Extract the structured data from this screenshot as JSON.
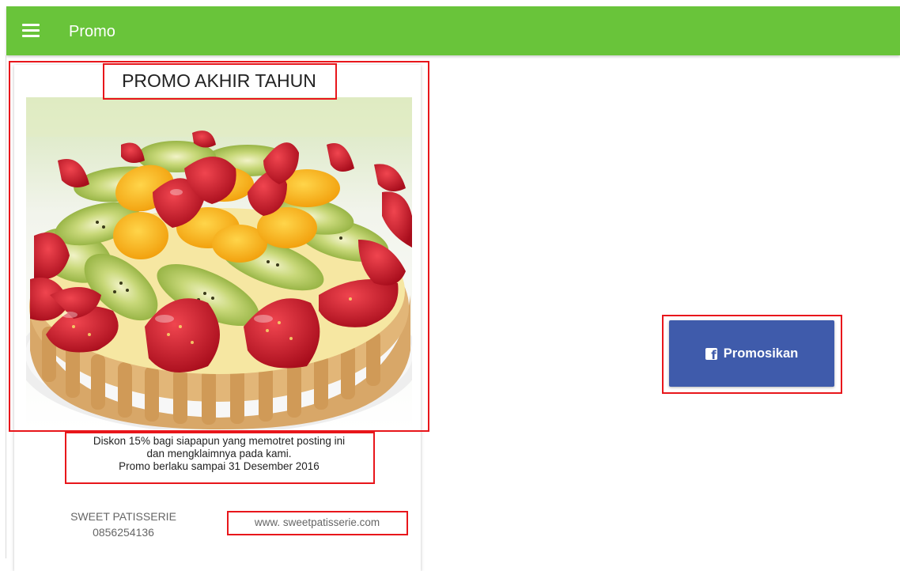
{
  "appbar": {
    "title": "Promo",
    "menu_icon": "hamburger-menu-icon",
    "color": "#69c43a"
  },
  "promo": {
    "title": "PROMO AKHIR TAHUN",
    "image": "fruit-tart-photo",
    "description_lines": [
      "Diskon 15% bagi siapapun yang memotret posting ini",
      "dan mengklaimnya pada kami.",
      "Promo berlaku sampai 31 Desember 2016"
    ],
    "shop_name": "SWEET PATISSERIE",
    "shop_phone": "0856254136",
    "website": "www. sweetpatisserie.com"
  },
  "share_button": {
    "label": "Promosikan",
    "icon": "facebook-icon",
    "color": "#3f5bab"
  },
  "highlight_color": "#e8161b"
}
